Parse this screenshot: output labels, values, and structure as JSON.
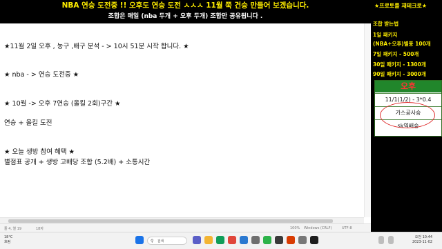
{
  "banner": {
    "line1": "NBA 연승 도전중 !! 오후도 연승 도전 ㅅㅅㅅ 11월 쭉 건승 만들어 보겠습니다.",
    "line2": "조합은 매일 (nba 두개 + 오후 두개) 조합만 공유됩니다 ."
  },
  "notepad": {
    "lines": [
      "★11월 2일  오후 , 농구 ,배구 분석  - > 10시 51분 시작 합니다.  ★",
      "★ nba - > 연승 도전중 ★",
      "★ 10월 -> 오후  7연승 (올킬 2회)구간 ★",
      "연승 + 올킬 도전",
      "★ 오늘 생방 참여 혜택 ★",
      "별점표 공개 + 생방 고배당 조합 (5.2배) + 소통시간"
    ],
    "status": {
      "position": "줄 4, 열 19",
      "chars": "18자",
      "zoom": "100%",
      "eol": "Windows (CRLF)",
      "encoding": "UTF-8"
    }
  },
  "sidebar": {
    "header": "★프로토를 재테크로★",
    "subheader": "조합 받는법",
    "packages": [
      "1일 패키지",
      "(NBA+오후)별풍 100개",
      "7일 패키지 - 500개",
      "30일 패키지 - 1300개",
      "90일 패키지 - 3000개"
    ],
    "pm_box": {
      "title": "오후",
      "rows": [
        "11/1(1/2) - 3*0.4",
        "가스공사승",
        "sk역배승"
      ]
    }
  },
  "taskbar": {
    "weather_temp": "18°C",
    "weather_desc": "흐림",
    "search_placeholder": "검색",
    "time": "오전 10:44",
    "date": "2023-11-02"
  },
  "colors": {
    "banner_text": "#ffee00",
    "pm_header": "#21862b",
    "pm_title": "#ff3333",
    "circle": "#e03030"
  }
}
